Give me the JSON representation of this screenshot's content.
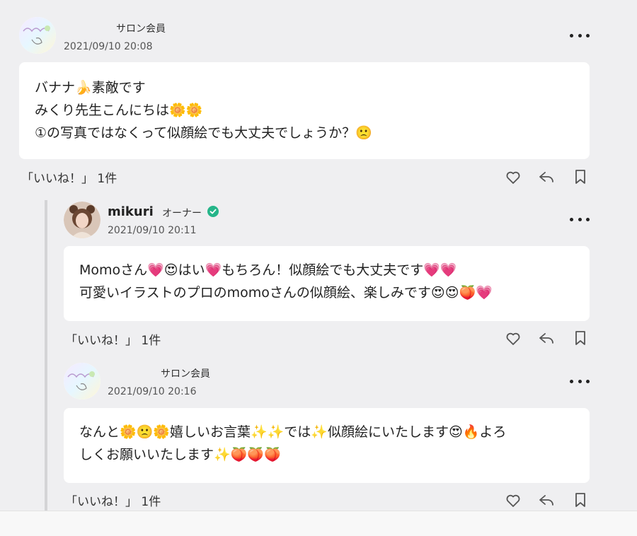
{
  "comments": [
    {
      "name": "サロン会員",
      "date": "2021/09/10 20:08",
      "lines": [
        "バナナ🍌素敵です",
        "みくり先生こんにちは🌼🌼",
        "①の写真ではなくって似顔絵でも大丈夫でしょうか？🙁"
      ],
      "like_label": "「いいね！」 1件"
    },
    {
      "name": "mikuri",
      "role": "オーナー",
      "date": "2021/09/10 20:11",
      "lines": [
        "Momoさん💗😍はい💗もちろん！似顔絵でも大丈夫です💗💗",
        "可愛いイラストのプロのmomoさんの似顔絵、楽しみです😍😍🍑💗"
      ],
      "like_label": "「いいね！」 1件"
    },
    {
      "name": "サロン会員",
      "date": "2021/09/10 20:16",
      "lines": [
        "なんと🌼🙁🌼嬉しいお言葉✨✨では✨似顔絵にいたします😍🔥よろ",
        "しくお願いいたします✨🍑🍑🍑"
      ],
      "like_label": "「いいね！」 1件"
    }
  ],
  "icons": [
    "more-icon",
    "heart-icon",
    "reply-icon",
    "bookmark-icon",
    "verified-icon"
  ],
  "colors": {
    "background": "#efeff1",
    "bubble": "#ffffff",
    "verified": "#25b589",
    "thread_line": "#d4d4d6"
  }
}
